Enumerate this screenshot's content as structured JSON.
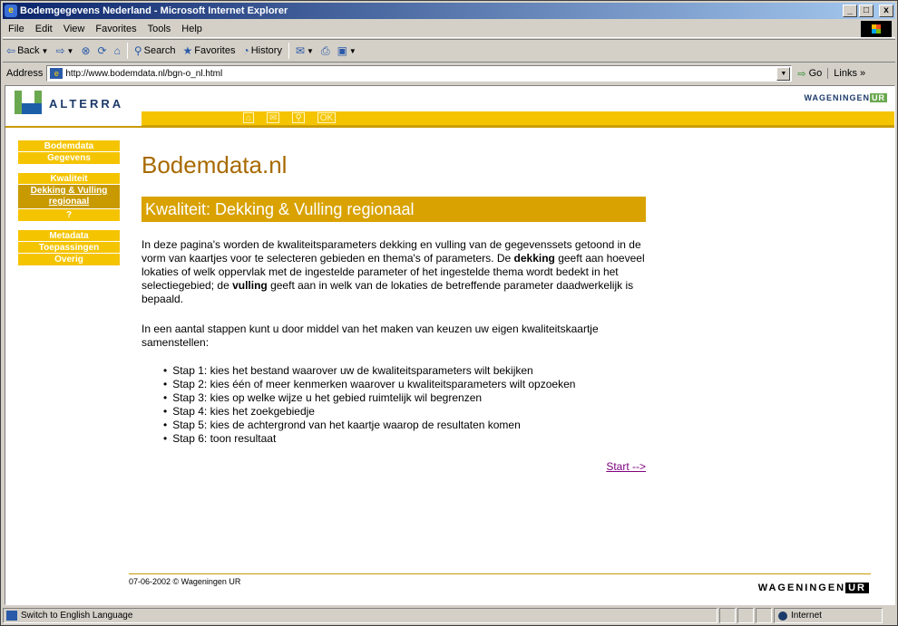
{
  "window": {
    "title": "Bodemgegevens Nederland - Microsoft Internet Explorer",
    "minimize": "_",
    "maximize": "□",
    "close": "x"
  },
  "menu": [
    "File",
    "Edit",
    "View",
    "Favorites",
    "Tools",
    "Help"
  ],
  "toolbar": {
    "back": "Back",
    "search": "Search",
    "favorites": "Favorites",
    "history": "History"
  },
  "address": {
    "label": "Address",
    "url": "http://www.bodemdata.nl/bgn-o_nl.html",
    "go": "Go",
    "links": "Links"
  },
  "header": {
    "logo_text": "ALTERRA",
    "partner_prefix": "WAGENINGEN",
    "partner_ur": "UR",
    "nav_icons": [
      "home-icon",
      "mail-icon",
      "search-icon",
      "ok-icon"
    ],
    "nav_icon_labels": [
      "⌂",
      "✉",
      "⚲",
      "OK"
    ]
  },
  "sidebar": {
    "group1": [
      "Bodemdata",
      "Gegevens"
    ],
    "group2": [
      "Kwaliteit",
      "Dekking & Vulling regionaal",
      "?"
    ],
    "group3": [
      "Metadata",
      "Toepassingen",
      "Overig"
    ]
  },
  "main": {
    "site_title": "Bodemdata.nl",
    "section_title": "Kwaliteit: Dekking & Vulling regionaal",
    "intro_1": "In deze pagina's worden de kwaliteitsparameters dekking en vulling van de gegevenssets getoond in de vorm van kaartjes voor te selecteren gebieden en thema's of parameters. De ",
    "intro_bold_1": "dekking",
    "intro_2": " geeft aan hoeveel lokaties of welk oppervlak met de ingestelde parameter of het ingestelde thema wordt bedekt in het selectiegebied; de ",
    "intro_bold_2": "vulling",
    "intro_3": " geeft aan in welk van de lokaties de betreffende parameter daadwerkelijk is bepaald.",
    "para2": "In een aantal stappen kunt u door middel van het maken van keuzen uw eigen kwaliteitskaartje samenstellen:",
    "steps": [
      "Stap 1: kies het bestand waarover uw de kwaliteitsparameters wilt bekijken",
      "Stap 2: kies één of meer kenmerken waarover u kwaliteitsparameters wilt opzoeken",
      "Stap 3: kies op welke wijze u het gebied ruimtelijk wil begrenzen",
      "Stap 4: kies het zoekgebiedje",
      "Stap 5: kies de achtergrond van het kaartje waarop de resultaten komen",
      "Stap 6: toon resultaat"
    ],
    "start_link": "Start -->"
  },
  "footer": {
    "date": "07-06-2002 © Wageningen UR",
    "partner_prefix": "WAGENINGEN",
    "partner_ur": "UR"
  },
  "status": {
    "text": "Switch to English Language",
    "zone": "Internet"
  }
}
